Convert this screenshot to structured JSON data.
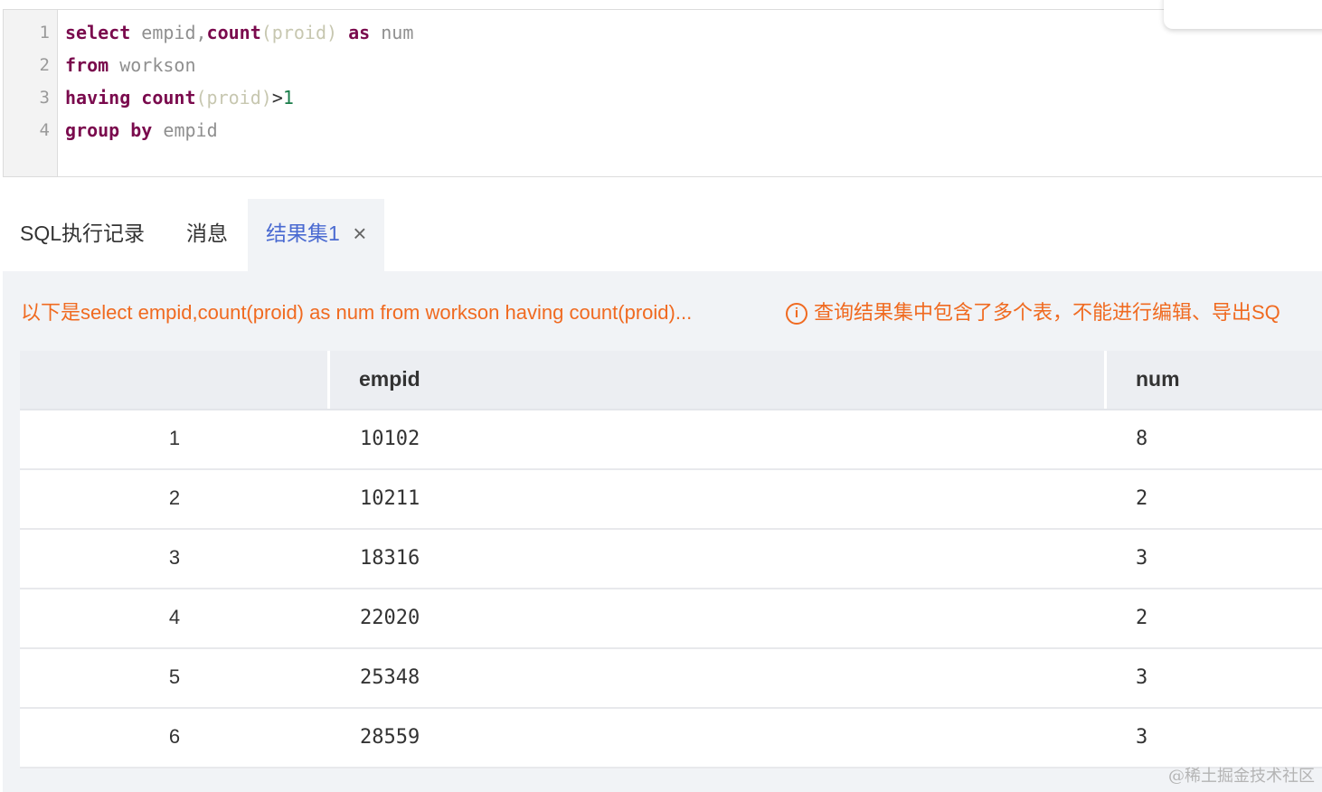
{
  "editor": {
    "line_numbers": [
      "1",
      "2",
      "3",
      "4"
    ],
    "lines": [
      [
        {
          "t": "select",
          "c": "kw"
        },
        {
          "t": " empid,",
          "c": ""
        },
        {
          "t": "count",
          "c": "kw"
        },
        {
          "t": "(proid)",
          "c": "paren"
        },
        {
          "t": " ",
          "c": ""
        },
        {
          "t": "as",
          "c": "kw"
        },
        {
          "t": " num",
          "c": ""
        }
      ],
      [
        {
          "t": "from",
          "c": "kw"
        },
        {
          "t": " workson",
          "c": ""
        }
      ],
      [
        {
          "t": "having",
          "c": "kw"
        },
        {
          "t": " ",
          "c": ""
        },
        {
          "t": "count",
          "c": "kw"
        },
        {
          "t": "(proid)",
          "c": "paren"
        },
        {
          "t": ">",
          "c": "op"
        },
        {
          "t": "1",
          "c": "num-lit"
        }
      ],
      [
        {
          "t": "group",
          "c": "kw"
        },
        {
          "t": " ",
          "c": ""
        },
        {
          "t": "by",
          "c": "kw"
        },
        {
          "t": " empid",
          "c": ""
        }
      ]
    ]
  },
  "tabs": {
    "history": "SQL执行记录",
    "messages": "消息",
    "result": "结果集1",
    "close_symbol": "×"
  },
  "result": {
    "query_summary": "以下是select empid,count(proid) as num from workson having count(proid)...",
    "notice_icon": "i",
    "notice": "查询结果集中包含了多个表，不能进行编辑、导出SQ",
    "columns": [
      "empid",
      "num"
    ],
    "rows": [
      {
        "index": "1",
        "empid": "10102",
        "num": "8"
      },
      {
        "index": "2",
        "empid": "10211",
        "num": "2"
      },
      {
        "index": "3",
        "empid": "18316",
        "num": "3"
      },
      {
        "index": "4",
        "empid": "22020",
        "num": "2"
      },
      {
        "index": "5",
        "empid": "25348",
        "num": "3"
      },
      {
        "index": "6",
        "empid": "28559",
        "num": "3"
      }
    ]
  },
  "watermark": "@稀土掘金技术社区",
  "colors": {
    "keyword": "#7a0a4d",
    "active_tab": "#4a6ad1",
    "warning": "#f06a20",
    "panel_bg": "#f1f3f6"
  }
}
